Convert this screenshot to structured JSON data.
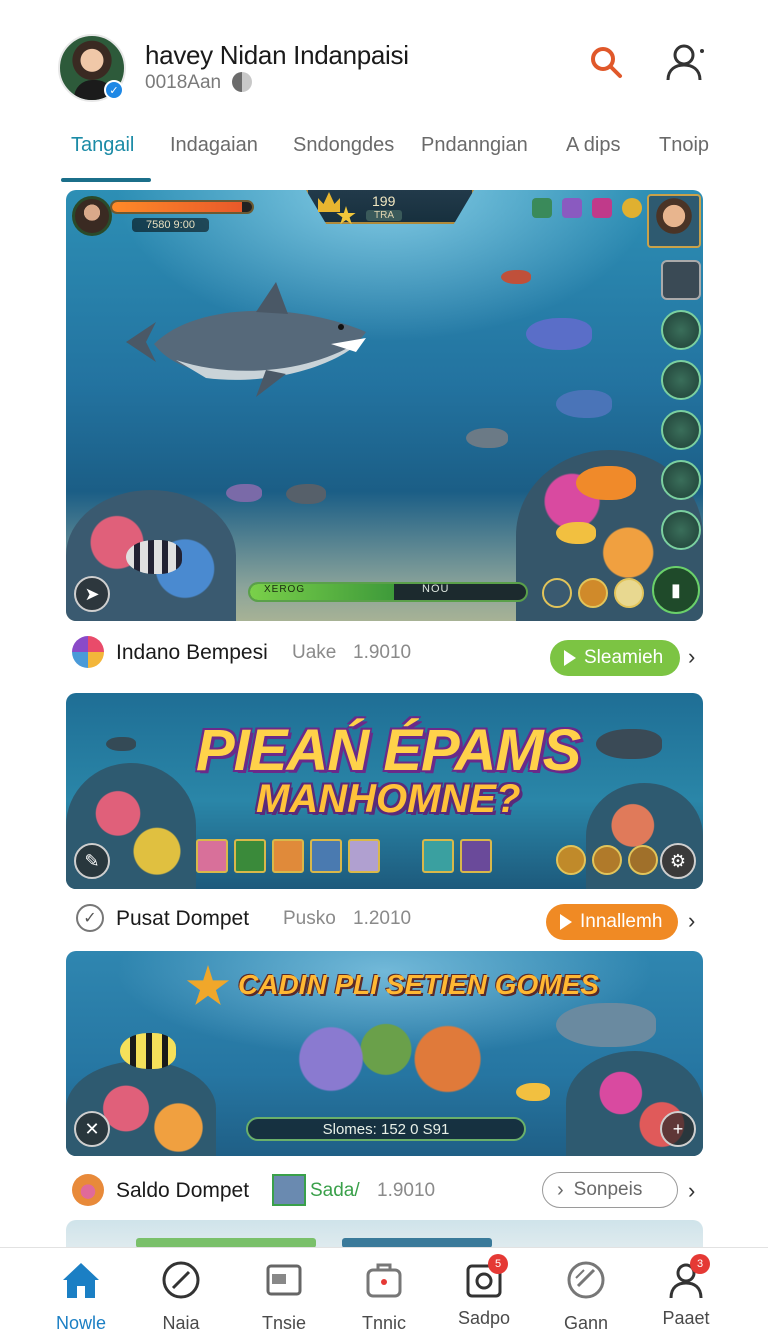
{
  "header": {
    "username": "havey Nidan Indanpaisi",
    "user_id": "0018Aan"
  },
  "tabs": [
    {
      "label": "Tangail",
      "active": true
    },
    {
      "label": "Indagaian",
      "active": false
    },
    {
      "label": "Sndongdes",
      "active": false
    },
    {
      "label": "Pndanngian",
      "active": false
    },
    {
      "label": "A dips",
      "active": false
    },
    {
      "label": "Tnoip",
      "active": false
    }
  ],
  "card1": {
    "hud_score": "7580 9:00",
    "hud_level": "199",
    "hud_sub": "TRA",
    "progress_left": "XEROG",
    "progress_right": "NOU",
    "progress_fraction": 0.52,
    "health_fraction": 0.93,
    "title": "Indano Bempesi",
    "sub": "Uake",
    "value": "1.9010",
    "button": "Sleamieh",
    "button_color": "#7cc443"
  },
  "card2": {
    "banner_line1": "PIEAŃ ÉPAMS",
    "banner_line2": "MANHOMNE?",
    "title": "Pusat Dompet",
    "sub": "Pusko",
    "value": "1.2010",
    "button": "Innallemh",
    "button_color": "#f08a24"
  },
  "card3": {
    "banner_title": "CADIN PLI SETIEN GOMES",
    "bar_text": "Slomes: 152 0 S91",
    "title": "Saldo Dompet",
    "sub": "Sada/",
    "value": "1.9010",
    "button": "Sonpeis"
  },
  "bottom_nav": [
    {
      "label": "Nowle",
      "icon": "home-icon",
      "active": true,
      "badge": ""
    },
    {
      "label": "Naia",
      "icon": "compass-icon",
      "active": false,
      "badge": ""
    },
    {
      "label": "Tnsie",
      "icon": "window-icon",
      "active": false,
      "badge": ""
    },
    {
      "label": "Tnnic",
      "icon": "briefcase-icon",
      "active": false,
      "badge": ""
    },
    {
      "label": "Sadpo",
      "icon": "camera-icon",
      "active": false,
      "badge": "5"
    },
    {
      "label": "Gann",
      "icon": "gauge-icon",
      "active": false,
      "badge": ""
    },
    {
      "label": "Paaet",
      "icon": "person-icon",
      "active": false,
      "badge": "3"
    }
  ],
  "colors": {
    "accent": "#1b8ba6",
    "search": "#e0582a",
    "nav_active": "#1b7fc4"
  }
}
